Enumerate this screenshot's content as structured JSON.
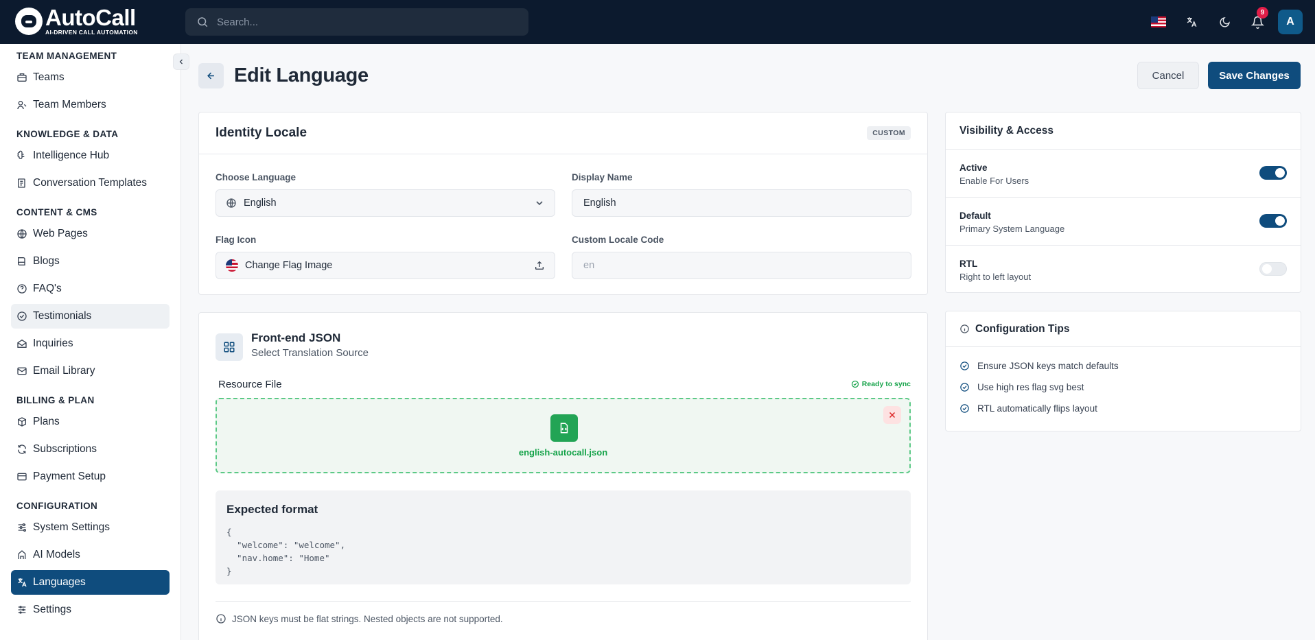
{
  "brand": {
    "name": "AutoCall",
    "tagline": "AI-DRIVEN CALL AUTOMATION"
  },
  "search": {
    "placeholder": "Search..."
  },
  "header": {
    "notification_count": "9",
    "avatar_initial": "A"
  },
  "sidebar": {
    "sections": [
      {
        "title": "TEAM MANAGEMENT",
        "items": [
          {
            "label": "Teams",
            "icon": "teams-icon"
          },
          {
            "label": "Team Members",
            "icon": "team-members-icon"
          }
        ]
      },
      {
        "title": "KNOWLEDGE & DATA",
        "items": [
          {
            "label": "Intelligence Hub",
            "icon": "brain-icon"
          },
          {
            "label": "Conversation Templates",
            "icon": "template-icon"
          }
        ]
      },
      {
        "title": "CONTENT & CMS",
        "items": [
          {
            "label": "Web Pages",
            "icon": "globe-icon"
          },
          {
            "label": "Blogs",
            "icon": "book-icon"
          },
          {
            "label": "FAQ's",
            "icon": "help-circle-icon"
          },
          {
            "label": "Testimonials",
            "icon": "quote-icon"
          },
          {
            "label": "Inquiries",
            "icon": "mail-open-icon"
          },
          {
            "label": "Email Library",
            "icon": "mail-icon"
          }
        ]
      },
      {
        "title": "BILLING & PLAN",
        "items": [
          {
            "label": "Plans",
            "icon": "package-icon"
          },
          {
            "label": "Subscriptions",
            "icon": "refresh-icon"
          },
          {
            "label": "Payment Setup",
            "icon": "credit-card-icon"
          }
        ]
      },
      {
        "title": "CONFIGURATION",
        "items": [
          {
            "label": "System Settings",
            "icon": "sliders-icon"
          },
          {
            "label": "AI Models",
            "icon": "ai-models-icon"
          },
          {
            "label": "Languages",
            "icon": "languages-icon"
          },
          {
            "label": "Settings",
            "icon": "settings-icon"
          }
        ]
      }
    ]
  },
  "page": {
    "title": "Edit Language",
    "cancel_label": "Cancel",
    "save_label": "Save Changes"
  },
  "identity": {
    "title": "Identity Locale",
    "tag": "CUSTOM",
    "choose_language_label": "Choose Language",
    "choose_language_value": "English",
    "display_name_label": "Display Name",
    "display_name_value": "English",
    "flag_icon_label": "Flag Icon",
    "flag_icon_button": "Change Flag Image",
    "locale_code_label": "Custom Locale Code",
    "locale_code_value": "en"
  },
  "json_section": {
    "title": "Front-end JSON",
    "subtitle": "Select Translation Source",
    "resource_label": "Resource File",
    "ready_status": "Ready to sync",
    "file_name": "english-autocall.json",
    "format_title": "Expected format",
    "format_code": "{\n  \"welcome\": \"welcome\",\n  \"nav.home\": \"Home\"\n}",
    "note": "JSON keys must be flat strings. Nested objects are not supported."
  },
  "visibility": {
    "title": "Visibility & Access",
    "rows": [
      {
        "title": "Active",
        "subtitle": "Enable For Users",
        "on": true
      },
      {
        "title": "Default",
        "subtitle": "Primary System Language",
        "on": true
      },
      {
        "title": "RTL",
        "subtitle": "Right to left layout",
        "on": false
      }
    ]
  },
  "tips": {
    "title": "Configuration Tips",
    "items": [
      "Ensure JSON keys match defaults",
      "Use high res flag svg best",
      "RTL automatically flips layout"
    ]
  },
  "colors": {
    "primary": "#0f4c7d",
    "topbar": "#0c1a2e",
    "success": "#16a34a",
    "danger": "#e11d48"
  }
}
